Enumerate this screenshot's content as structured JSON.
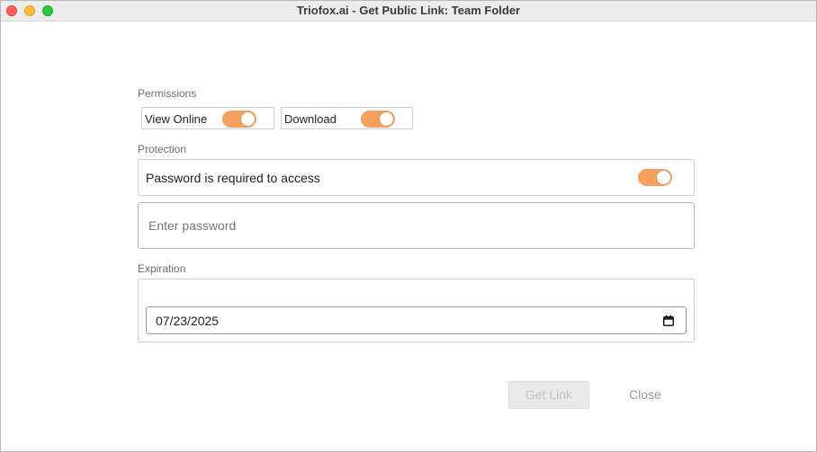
{
  "window": {
    "title": "Triofox.ai - Get Public Link: Team Folder"
  },
  "permissions": {
    "label": "Permissions",
    "view_online": {
      "label": "View Online",
      "enabled": true
    },
    "download": {
      "label": "Download",
      "enabled": true
    }
  },
  "protection": {
    "label": "Protection",
    "password_required": {
      "label": "Password is required to access",
      "enabled": true
    },
    "password_input": {
      "placeholder": "Enter password",
      "value": ""
    }
  },
  "expiration": {
    "label": "Expiration",
    "date_value": "07/23/2025"
  },
  "actions": {
    "get_link_label": "Get Link",
    "get_link_disabled": true,
    "close_label": "Close"
  },
  "colors": {
    "toggle_on": "#f5a05e",
    "close_light": "#fe5f57",
    "minimize_light": "#febc2e",
    "maximize_light": "#28c840"
  },
  "icons": {
    "calendar": "calendar-icon"
  }
}
